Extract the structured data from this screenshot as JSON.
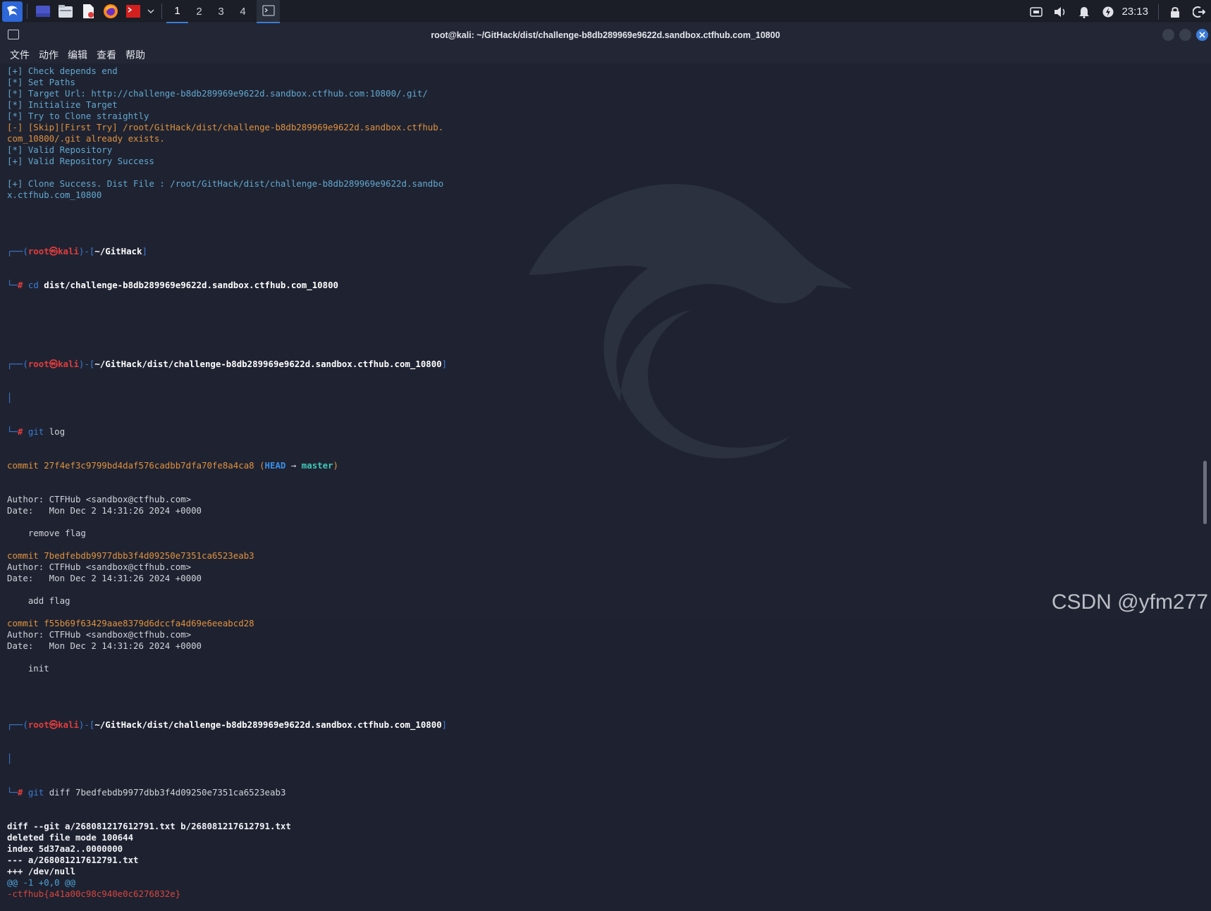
{
  "taskbar": {
    "workspaces": [
      "1",
      "2",
      "3",
      "4"
    ],
    "active_workspace": 0,
    "clock": "23:13",
    "accent": "#3b7dd8"
  },
  "window": {
    "title": "root@kali: ~/GitHack/dist/challenge-b8db289969e9622d.sandbox.ctfhub.com_10800",
    "menu": [
      "文件",
      "动作",
      "编辑",
      "查看",
      "帮助"
    ]
  },
  "terminal": {
    "intro": [
      {
        "cls": "c-cyan",
        "text": "[+] Check depends end"
      },
      {
        "cls": "c-cyan",
        "text": "[*] Set Paths"
      },
      {
        "cls": "c-cyan",
        "text": "[*] Target Url: http://challenge-b8db289969e9622d.sandbox.ctfhub.com:10800/.git/"
      },
      {
        "cls": "c-cyan",
        "text": "[*] Initialize Target"
      },
      {
        "cls": "c-cyan",
        "text": "[*] Try to Clone straightly"
      },
      {
        "cls": "c-orange",
        "text": "[-] [Skip][First Try] /root/GitHack/dist/challenge-b8db289969e9622d.sandbox.ctfhub."
      },
      {
        "cls": "c-orange",
        "text": "com_10800/.git already exists."
      },
      {
        "cls": "c-cyan",
        "text": "[*] Valid Repository"
      },
      {
        "cls": "c-cyan",
        "text": "[+] Valid Repository Success"
      },
      {
        "cls": "",
        "text": ""
      },
      {
        "cls": "c-cyan",
        "text": "[+] Clone Success. Dist File : /root/GitHack/dist/challenge-b8db289969e9622d.sandbo"
      },
      {
        "cls": "c-cyan",
        "text": "x.ctfhub.com_10800"
      },
      {
        "cls": "",
        "text": ""
      }
    ],
    "prompt_user": "root",
    "prompt_at": "㉿",
    "prompt_host": "kali",
    "prompt1_path": "~/GitHack",
    "prompt1_cmd": "cd",
    "prompt1_arg": " dist/challenge-b8db289969e9622d.sandbox.ctfhub.com_10800",
    "prompt2_path": "~/GitHack/dist/challenge-b8db289969e9622d.sandbox.ctfhub.com_10800",
    "prompt2_cmd": "git",
    "prompt2_arg": " log",
    "head_commit": "commit 27f4ef3c9799bd4daf576cadbb7dfa70fe8a4ca8",
    "head_label": "HEAD",
    "head_arrow": " → ",
    "head_branch": "master",
    "log_lines": [
      {
        "cls": "c-gray",
        "text": "Author: CTFHub <sandbox@ctfhub.com>"
      },
      {
        "cls": "c-gray",
        "text": "Date:   Mon Dec 2 14:31:26 2024 +0000"
      },
      {
        "cls": "",
        "text": ""
      },
      {
        "cls": "c-gray",
        "text": "    remove flag"
      },
      {
        "cls": "",
        "text": ""
      },
      {
        "cls": "c-orange",
        "text": "commit 7bedfebdb9977dbb3f4d09250e7351ca6523eab3"
      },
      {
        "cls": "c-gray",
        "text": "Author: CTFHub <sandbox@ctfhub.com>"
      },
      {
        "cls": "c-gray",
        "text": "Date:   Mon Dec 2 14:31:26 2024 +0000"
      },
      {
        "cls": "",
        "text": ""
      },
      {
        "cls": "c-gray",
        "text": "    add flag"
      },
      {
        "cls": "",
        "text": ""
      },
      {
        "cls": "c-orange",
        "text": "commit f55b69f63429aae8379d6dccfa4d69e6eeabcd28"
      },
      {
        "cls": "c-gray",
        "text": "Author: CTFHub <sandbox@ctfhub.com>"
      },
      {
        "cls": "c-gray",
        "text": "Date:   Mon Dec 2 14:31:26 2024 +0000"
      },
      {
        "cls": "",
        "text": ""
      },
      {
        "cls": "c-gray",
        "text": "    init"
      },
      {
        "cls": "",
        "text": ""
      }
    ],
    "prompt3_path": "~/GitHack/dist/challenge-b8db289969e9622d.sandbox.ctfhub.com_10800",
    "prompt3_cmd": "git",
    "prompt3_arg": " diff 7bedfebdb9977dbb3f4d09250e7351ca6523eab3",
    "diff_lines": [
      {
        "cls": "c-bold",
        "text": "diff --git a/268081217612791.txt b/268081217612791.txt"
      },
      {
        "cls": "c-bold",
        "text": "deleted file mode 100644"
      },
      {
        "cls": "c-bold",
        "text": "index 5d37aa2..0000000"
      },
      {
        "cls": "c-bold",
        "text": "--- a/268081217612791.txt"
      },
      {
        "cls": "c-bold",
        "text": "+++ /dev/null"
      },
      {
        "cls": "c-diffcyan",
        "text": "@@ -1 +0,0 @@"
      },
      {
        "cls": "c-diffred",
        "text": "-ctfhub{a41a00c98c940e0c6276832e}"
      }
    ]
  },
  "watermark": "CSDN @yfm277"
}
